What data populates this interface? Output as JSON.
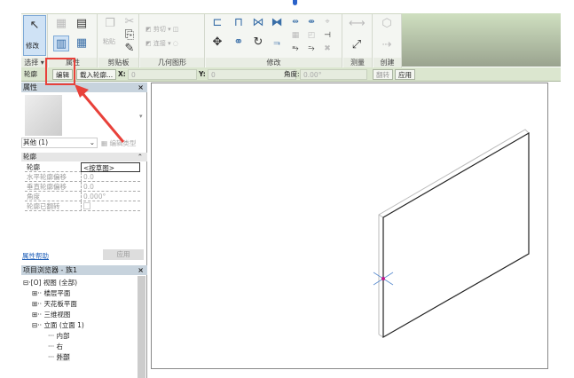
{
  "ribbon": {
    "select_panel": {
      "modify_label": "修改",
      "panel_label": "选择 ▾"
    },
    "properties_panel": {
      "panel_label": "属性"
    },
    "clipboard_panel": {
      "paste_label": "粘贴",
      "panel_label": "剪贴板"
    },
    "geometry_panel": {
      "cut_label": "剪切",
      "join_label": "连接",
      "panel_label": "几何图形"
    },
    "modify_panel": {
      "panel_label": "修改"
    },
    "measure_panel": {
      "panel_label": "测量"
    },
    "create_panel": {
      "panel_label": "创建"
    }
  },
  "options_bar": {
    "context_label": "轮廓",
    "edit_button": "编辑",
    "load_profile_button": "载入轮廓...",
    "x_label": "X:",
    "x_value": "0",
    "y_label": "Y:",
    "y_value": "0",
    "angle_label": "角度:",
    "angle_value": "0.00°",
    "flip_button": "翻转",
    "apply_button": "应用"
  },
  "properties": {
    "title": "属性",
    "type_selector": "其他 (1)",
    "edit_type_button": "编辑类型",
    "group_label": "轮廓",
    "rows": [
      {
        "key": "轮廓",
        "value": "<按草图>"
      },
      {
        "key": "水平轮廓偏移",
        "value": "0.0"
      },
      {
        "key": "垂直轮廓偏移",
        "value": "0.0"
      },
      {
        "key": "角度",
        "value": "0.000°"
      },
      {
        "key": "轮廓已翻转",
        "value": ""
      }
    ],
    "help_link": "属性帮助",
    "apply_button": "应用"
  },
  "project_browser": {
    "title": "项目浏览器 - 族1",
    "items": [
      "视图 (全部)",
      "楼层平面",
      "天花板平面",
      "三维视图",
      "立面 (立面 1)",
      "内部",
      "右",
      "外部"
    ]
  },
  "colors": {
    "accent": "#3a6fa8",
    "annotation": "#e8413a",
    "option_bar": "#dbe6cf"
  }
}
